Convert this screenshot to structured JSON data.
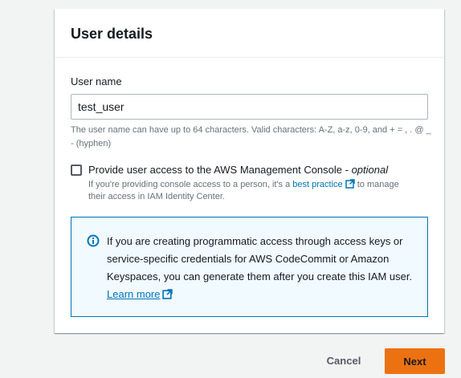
{
  "panel": {
    "title": "User details"
  },
  "username": {
    "label": "User name",
    "value": "test_user",
    "hint": "The user name can have up to 64 characters. Valid characters: A-Z, a-z, 0-9, and + = , . @ _ - (hyphen)"
  },
  "console_access": {
    "label": "Provide user access to the AWS Management Console - ",
    "optional": "optional",
    "checked": false,
    "desc_before": "If you're providing console access to a person, it's a ",
    "desc_link": "best practice",
    "desc_after": " to manage their access in IAM Identity Center."
  },
  "info": {
    "text": "If you are creating programmatic access through access keys or service-specific credentials for AWS CodeCommit or Amazon Keyspaces, you can generate them after you create this IAM user. ",
    "link": "Learn more"
  },
  "footer": {
    "cancel_label": "Cancel",
    "next_label": "Next"
  },
  "colors": {
    "accent": "#ec7211",
    "link": "#0073bb",
    "info_bg": "#f1faff"
  },
  "icons": {
    "external_link": "external-link-icon",
    "info": "info-icon"
  }
}
